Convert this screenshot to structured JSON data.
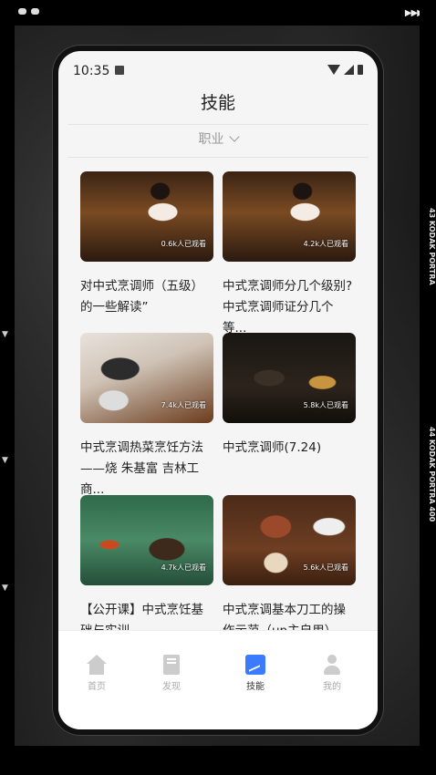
{
  "status": {
    "time": "10:35"
  },
  "header": {
    "title": "技能"
  },
  "filter": {
    "label": "职业"
  },
  "videos": [
    {
      "title": "对中式烹调师（五级）的一些解读”",
      "views": "0.6k人已观看"
    },
    {
      "title": "中式烹调师分几个级别?中式烹调师证分几个等...",
      "views": "4.2k人已观看"
    },
    {
      "title": "中式烹调热菜烹饪方法 ——烧 朱基富 吉林工商...",
      "views": "7.4k人已观看"
    },
    {
      "title": "中式烹调师(7.24)",
      "views": "5.8k人已观看"
    },
    {
      "title": "【公开课】中式烹饪基础与实训",
      "views": "4.7k人已观看"
    },
    {
      "title": "中式烹调基本刀工的操作示范（up主自用）",
      "views": "5.6k人已观看"
    }
  ],
  "tabbar": {
    "items": [
      {
        "label": "首页",
        "icon": "home-icon"
      },
      {
        "label": "发现",
        "icon": "book-icon"
      },
      {
        "label": "技能",
        "icon": "chart-icon"
      },
      {
        "label": "我的",
        "icon": "user-icon"
      }
    ],
    "active": "技能"
  },
  "colors": {
    "accent": "#3b7bff",
    "background": "#f5f5f5"
  }
}
